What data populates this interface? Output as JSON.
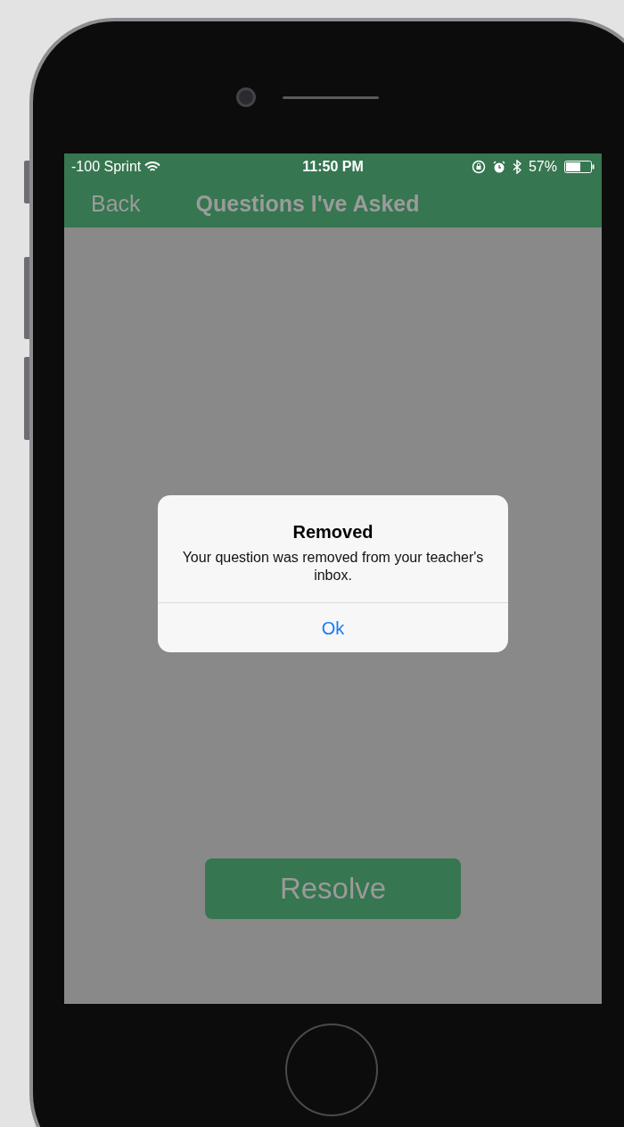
{
  "status_bar": {
    "carrier": "-100 Sprint",
    "time": "11:50 PM",
    "battery": "57%"
  },
  "nav_bar": {
    "back": "Back",
    "title": "Questions I've Asked"
  },
  "alert": {
    "title": "Removed",
    "message": "Your question was removed from your teacher's inbox.",
    "button": "Ok"
  },
  "resolve_button": "Resolve"
}
